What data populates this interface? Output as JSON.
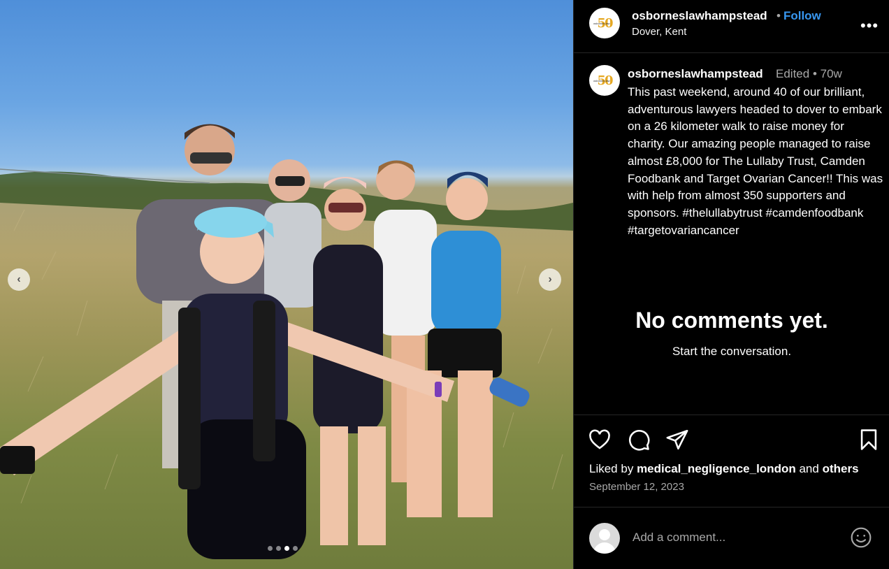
{
  "post": {
    "username": "osborneslawhampstead",
    "follow_label": "Follow",
    "separator": "•",
    "location": "Dover, Kent",
    "logo_text": "50",
    "logo_small_text": "osbornes law"
  },
  "caption": {
    "username": "osborneslawhampstead",
    "edited_label": "Edited",
    "age": "70w",
    "text": "This past weekend, around 40 of our brilliant, adventurous lawyers headed to dover to embark on a 26 kilometer walk to raise money for charity. Our amazing people managed to raise almost £8,000 for The Lullaby Trust, Camden Foodbank and Target Ovarian Cancer!! This was with help from almost 350 supporters and sponsors. #thelullabytrust #camdenfoodbank #targetovariancancer"
  },
  "comments": {
    "empty_title": "No comments yet.",
    "empty_subtitle": "Start the conversation."
  },
  "engagement": {
    "liked_prefix": "Liked by",
    "liked_user": "medical_negligence_london",
    "liked_and": "and",
    "liked_others": "others",
    "date": "September 12, 2023"
  },
  "comment_box": {
    "placeholder": "Add a comment..."
  },
  "carousel": {
    "prev_icon": "chevron-left-icon",
    "next_icon": "chevron-right-icon",
    "slide_count": 4,
    "active_slide": 3
  },
  "colors": {
    "accent_link": "#3897f0",
    "muted_text": "#a8a8a8",
    "divider": "#262626",
    "logo_gold": "#e5a823"
  }
}
